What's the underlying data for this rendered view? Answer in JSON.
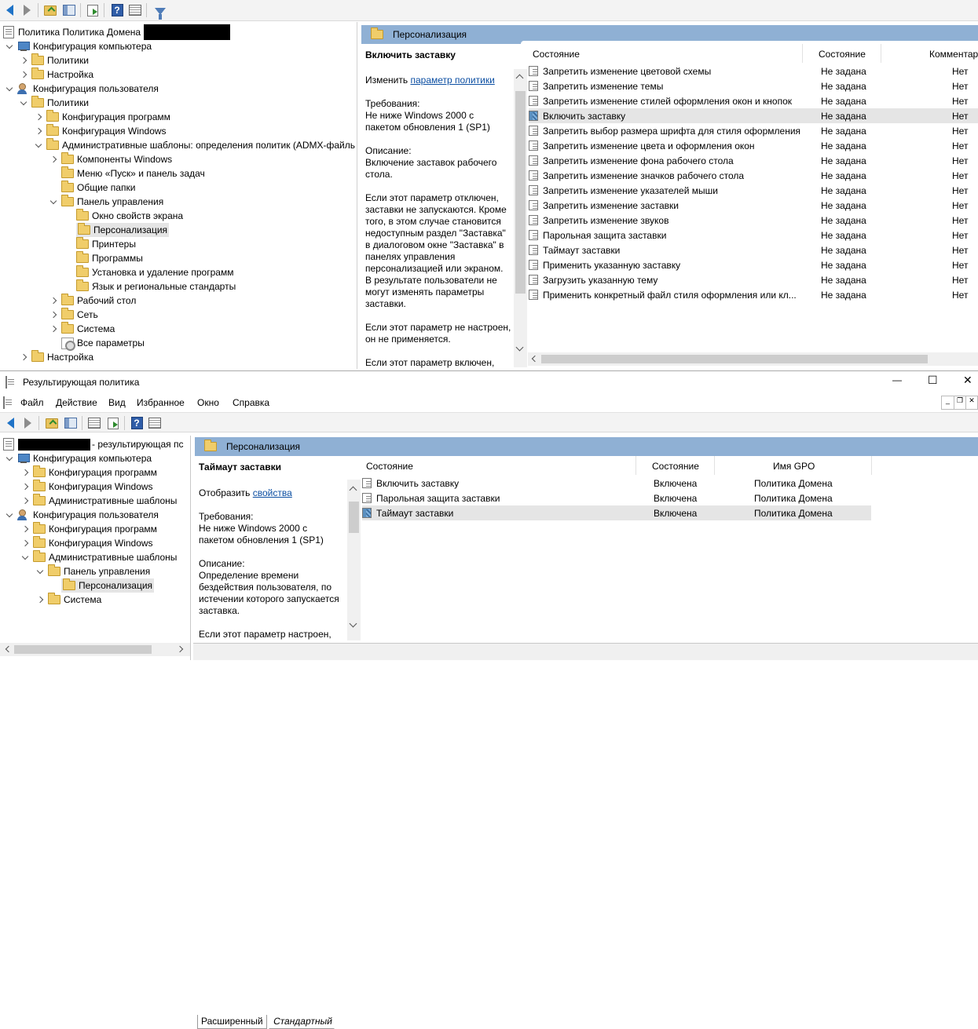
{
  "top_toolbar": {
    "icons": [
      "back-icon",
      "forward-icon",
      "up-folder-icon",
      "show-hide-tree-icon",
      "export-list-icon",
      "help-icon",
      "properties-icon",
      "filter-icon"
    ]
  },
  "top_tree": {
    "root": "Политика Политика Домена",
    "items": [
      {
        "label": "Конфигурация компьютера"
      },
      {
        "label": "Политики"
      },
      {
        "label": "Настройка"
      },
      {
        "label": "Конфигурация пользователя"
      },
      {
        "label": "Политики"
      },
      {
        "label": "Конфигурация программ"
      },
      {
        "label": "Конфигурация Windows"
      },
      {
        "label": "Административные шаблоны: определения политик (ADMX-файль"
      },
      {
        "label": "Компоненты Windows"
      },
      {
        "label": "Меню «Пуск» и панель задач"
      },
      {
        "label": "Общие папки"
      },
      {
        "label": "Панель управления"
      },
      {
        "label": "Окно свойств экрана"
      },
      {
        "label": "Персонализация"
      },
      {
        "label": "Принтеры"
      },
      {
        "label": "Программы"
      },
      {
        "label": "Установка и удаление программ"
      },
      {
        "label": "Язык и региональные стандарты"
      },
      {
        "label": "Рабочий стол"
      },
      {
        "label": "Сеть"
      },
      {
        "label": "Система"
      },
      {
        "label": "Все параметры"
      },
      {
        "label": "Настройка"
      }
    ]
  },
  "top_right": {
    "header": "Персонализация",
    "desc_title": "Включить заставку",
    "edit_prefix": "Изменить ",
    "edit_link": "параметр политики",
    "desc_text": "Требования:\nНе ниже Windows 2000 с\nпакетом обновления 1 (SP1)\n\nОписание:\nВключение заставок рабочего\nстола.\n\nЕсли этот параметр отключен,\nзаставки не запускаются. Кроме\nтого, в этом случае становится\nнедоступным раздел \"Заставка\"\nв диалоговом окне \"Заставка\" в\nпанелях управления\nперсонализацией или экраном.\nВ результате пользователи не\nмогут изменять параметры\nзаставки.\n\nЕсли этот параметр не настроен,\nон не применяется.\n\nЕсли этот параметр включен,",
    "columns": [
      "Состояние",
      "Состояние",
      "Комментар"
    ],
    "rows": [
      {
        "name": "Запретить изменение цветовой схемы",
        "state": "Не задана",
        "comment": "Нет"
      },
      {
        "name": "Запретить изменение темы",
        "state": "Не задана",
        "comment": "Нет"
      },
      {
        "name": "Запретить изменение стилей оформления окон и кнопок",
        "state": "Не задана",
        "comment": "Нет"
      },
      {
        "name": "Включить заставку",
        "state": "Не задана",
        "comment": "Нет"
      },
      {
        "name": "Запретить выбор размера шрифта для стиля оформления",
        "state": "Не задана",
        "comment": "Нет"
      },
      {
        "name": "Запретить изменение цвета и оформления окон",
        "state": "Не задана",
        "comment": "Нет"
      },
      {
        "name": "Запретить изменение фона рабочего стола",
        "state": "Не задана",
        "comment": "Нет"
      },
      {
        "name": "Запретить изменение значков рабочего стола",
        "state": "Не задана",
        "comment": "Нет"
      },
      {
        "name": "Запретить изменение указателей мыши",
        "state": "Не задана",
        "comment": "Нет"
      },
      {
        "name": "Запретить изменение заставки",
        "state": "Не задана",
        "comment": "Нет"
      },
      {
        "name": "Запретить изменение звуков",
        "state": "Не задана",
        "comment": "Нет"
      },
      {
        "name": "Парольная защита заставки",
        "state": "Не задана",
        "comment": "Нет"
      },
      {
        "name": "Таймаут заставки",
        "state": "Не задана",
        "comment": "Нет"
      },
      {
        "name": "Применить указанную заставку",
        "state": "Не задана",
        "comment": "Нет"
      },
      {
        "name": "Загрузить указанную тему",
        "state": "Не задана",
        "comment": "Нет"
      },
      {
        "name": "Применить конкретный файл стиля оформления или кл...",
        "state": "Не задана",
        "comment": "Нет"
      }
    ]
  },
  "rsop_window": {
    "title": "Результирующая политика",
    "controls": {
      "minimize": "—",
      "maximize": "☐",
      "close": "✕"
    },
    "menu": [
      "Файл",
      "Действие",
      "Вид",
      "Избранное",
      "Окно",
      "Справка"
    ],
    "tree": {
      "root_suffix": "- результирующая пс",
      "items": [
        {
          "label": "Конфигурация компьютера"
        },
        {
          "label": "Конфигурация программ"
        },
        {
          "label": "Конфигурация Windows"
        },
        {
          "label": "Административные шаблоны"
        },
        {
          "label": "Конфигурация пользователя"
        },
        {
          "label": "Конфигурация программ"
        },
        {
          "label": "Конфигурация Windows"
        },
        {
          "label": "Административные шаблоны"
        },
        {
          "label": "Панель управления"
        },
        {
          "label": "Персонализация"
        },
        {
          "label": "Система"
        }
      ]
    },
    "right": {
      "header": "Персонализация",
      "desc_title": "Таймаут заставки",
      "show_prefix": "Отобразить ",
      "show_link": "свойства ",
      "desc_text": "Требования:\nНе ниже Windows 2000 с\nпакетом обновления 1 (SP1)\n\nОписание:\nОпределение времени\nбездействия пользователя, по\nистечении которого запускается\nзаставка.\n\nЕсли этот параметр настроен,",
      "columns": [
        "Состояние",
        "Состояние",
        "Имя GPO"
      ],
      "rows": [
        {
          "name": "Включить заставку",
          "state": "Включена",
          "gpo": "Политика Домена"
        },
        {
          "name": "Парольная защита заставки",
          "state": "Включена",
          "gpo": "Политика Домена"
        },
        {
          "name": "Таймаут заставки",
          "state": "Включена",
          "gpo": "Политика Домена"
        }
      ]
    },
    "tabs": [
      "Расширенный",
      "Стандартный"
    ]
  },
  "colors": {
    "header_blue": "#8fb0d4",
    "selection_gray": "#e5e5e5",
    "link_blue": "#0b4ea2",
    "folder_yellow": "#f0cd6a"
  }
}
